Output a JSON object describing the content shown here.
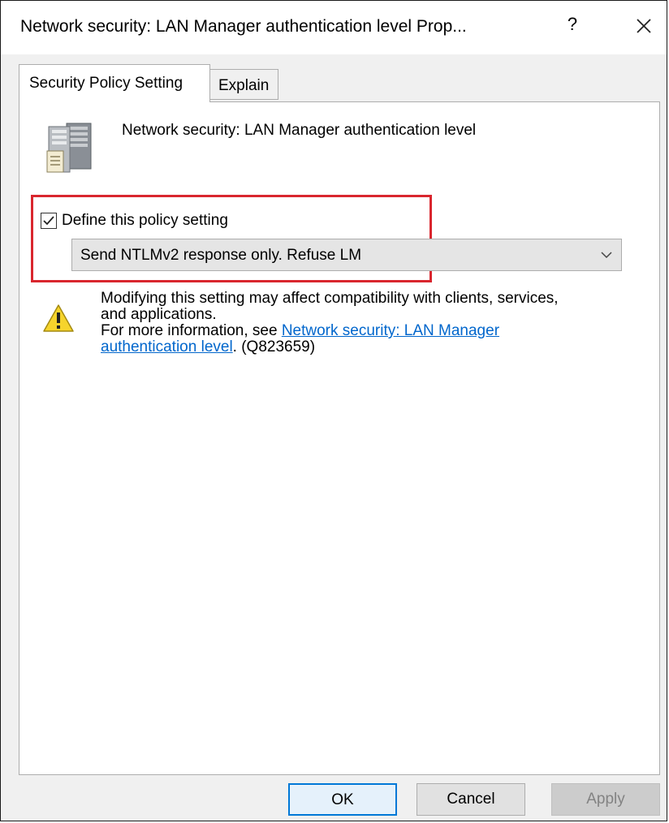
{
  "window": {
    "title": "Network security: LAN Manager authentication level Prop...",
    "help_glyph": "?",
    "close_icon": "close-icon"
  },
  "tabs": [
    {
      "label": "Security Policy Setting",
      "active": true
    },
    {
      "label": "Explain",
      "active": false
    }
  ],
  "policy": {
    "icon": "server-icon",
    "name": "Network security: LAN Manager authentication level",
    "define_label": "Define this policy setting",
    "define_checked": true,
    "selected_option": "Send NTLMv2 response only. Refuse LM"
  },
  "warning": {
    "icon": "warning-icon",
    "line1": "Modifying this setting may affect compatibility with clients, services,",
    "line2": "and applications.",
    "more_prefix": "For more information, see ",
    "link_line1": "Network security: LAN Manager",
    "link_line2": "authentication level",
    "suffix": ". (Q823659)"
  },
  "buttons": {
    "ok": "OK",
    "cancel": "Cancel",
    "apply": "Apply"
  },
  "colors": {
    "highlight": "#d9262e",
    "link": "#0066cc",
    "default_button_border": "#0078d7"
  }
}
